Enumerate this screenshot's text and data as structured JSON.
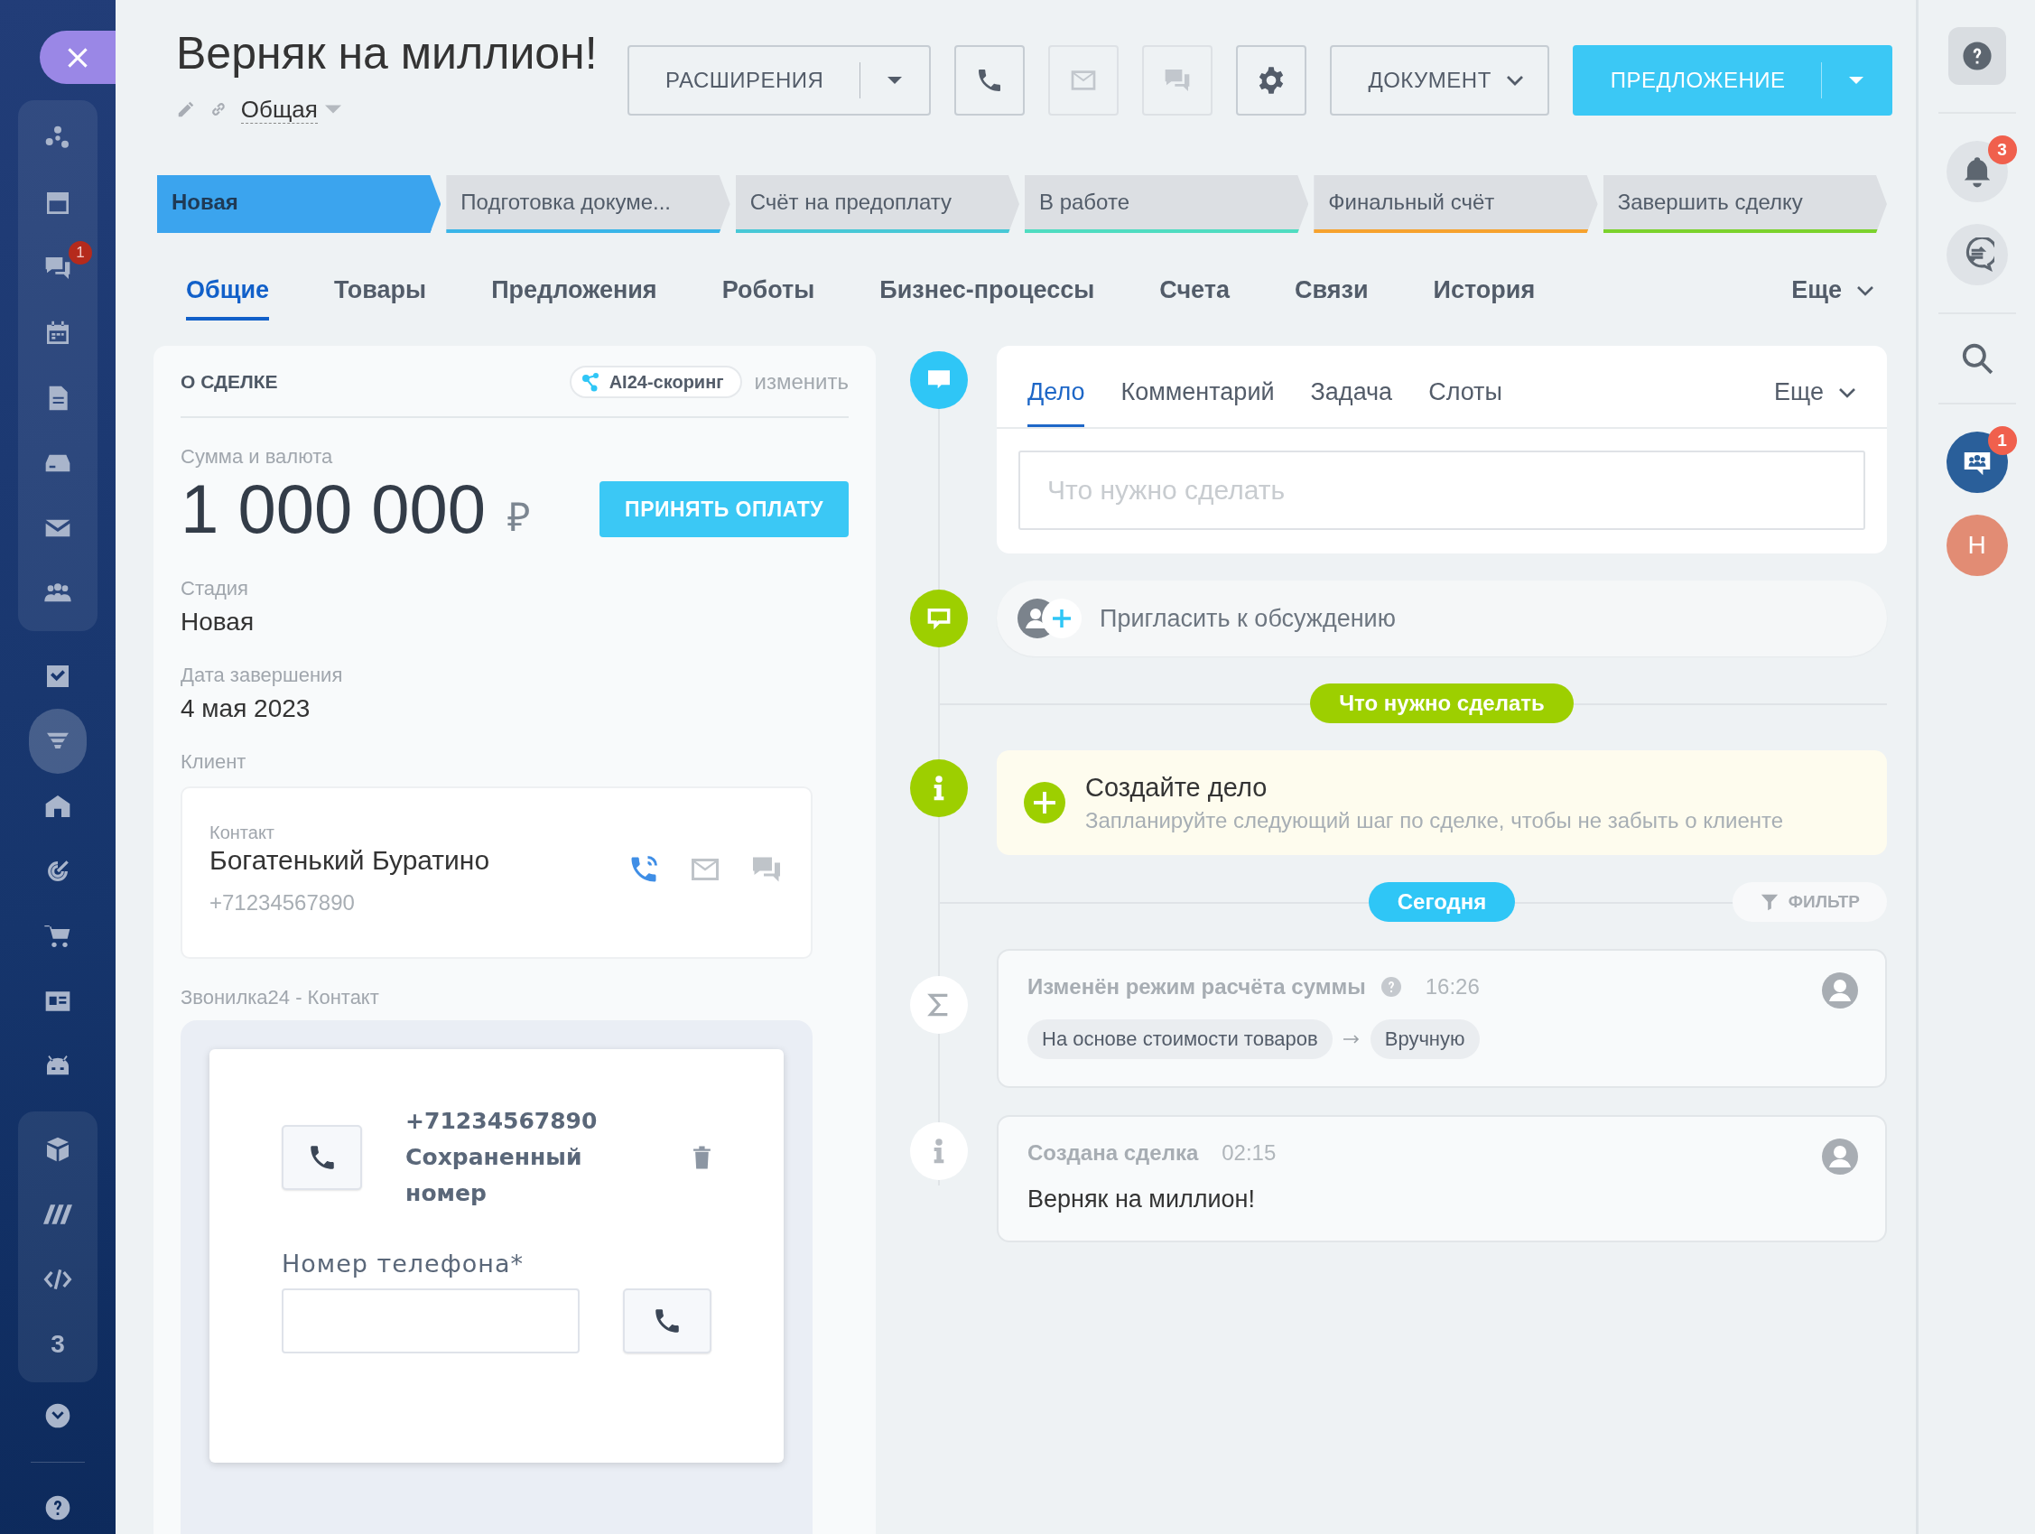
{
  "sidebar": {
    "groups": [
      {
        "boxed": true,
        "items": [
          {
            "selected": false
          },
          {
            "selected": false
          },
          {
            "selected": false,
            "badge": "1"
          },
          {
            "selected": false
          },
          {
            "selected": false
          },
          {
            "selected": false
          },
          {
            "selected": false
          },
          {
            "selected": false
          }
        ]
      },
      {
        "boxed": false,
        "items": [
          {
            "selected": false
          },
          {
            "selected": true
          },
          {
            "selected": false
          },
          {
            "selected": false
          },
          {
            "selected": false
          },
          {
            "selected": false
          },
          {
            "selected": false
          }
        ]
      },
      {
        "boxed": true,
        "items": [
          {
            "selected": false
          },
          {
            "selected": false
          },
          {
            "selected": false
          },
          {
            "selected": false,
            "text": "3"
          }
        ]
      }
    ]
  },
  "header": {
    "title": "Верняк на миллион!",
    "category": "Общая",
    "toolbar": [
      {
        "kind": "split",
        "label": "РАСШИРЕНИЯ",
        "primary": false
      },
      {
        "kind": "icon",
        "disabled": false
      },
      {
        "kind": "icon",
        "disabled": true
      },
      {
        "kind": "icon",
        "disabled": true
      },
      {
        "kind": "icon",
        "disabled": false
      },
      {
        "kind": "dropdown",
        "label": "ДОКУМЕНТ"
      },
      {
        "kind": "split",
        "label": "ПРЕДЛОЖЕНИЕ",
        "primary": true
      }
    ]
  },
  "stages": [
    {
      "label": "Новая",
      "selected": true,
      "color": "#3ba4ee"
    },
    {
      "label": "Подготовка докуме...",
      "selected": false,
      "color": "#39b5e8"
    },
    {
      "label": "Счёт на предоплату",
      "selected": false,
      "color": "#47c8d6"
    },
    {
      "label": "В работе",
      "selected": false,
      "color": "#4fdcc0"
    },
    {
      "label": "Финальный счёт",
      "selected": false,
      "color": "#f6a22e"
    },
    {
      "label": "Завершить сделку",
      "selected": false,
      "color": "#7bd22c"
    }
  ],
  "tabs": [
    {
      "label": "Общие",
      "selected": true
    },
    {
      "label": "Товары",
      "selected": false
    },
    {
      "label": "Предложения",
      "selected": false
    },
    {
      "label": "Роботы",
      "selected": false
    },
    {
      "label": "Бизнес-процессы",
      "selected": false
    },
    {
      "label": "Счета",
      "selected": false
    },
    {
      "label": "Связи",
      "selected": false
    },
    {
      "label": "История",
      "selected": false
    }
  ],
  "tabs_more": "Еще",
  "deal": {
    "title": "О СДЕЛКЕ",
    "scoring": "AI24-скоринг",
    "edit": "изменить",
    "amount_label": "Сумма и валюта",
    "amount": "1 000 000",
    "currency": "₽",
    "pay_button": "ПРИНЯТЬ ОПЛАТУ",
    "stage_label": "Стадия",
    "stage": "Новая",
    "date_label": "Дата завершения",
    "date": "4 мая 2023",
    "client_label": "Клиент",
    "contact": {
      "caption": "Контакт",
      "name": "Богатенький Буратино",
      "phone": "+71234567890"
    },
    "widget_label": "Звонилка24 - Контакт",
    "widget": {
      "phone": "+71234567890",
      "note": "Сохраненный номер",
      "field_label": "Номер телефона*"
    }
  },
  "timeline": {
    "composer": {
      "tabs": [
        {
          "label": "Дело",
          "selected": true
        },
        {
          "label": "Комментарий",
          "selected": false
        },
        {
          "label": "Задача",
          "selected": false
        },
        {
          "label": "Слоты",
          "selected": false
        }
      ],
      "more": "Еще",
      "placeholder": "Что нужно сделать"
    },
    "invite": "Пригласить к обсуждению",
    "todo_divider": "Что нужно сделать",
    "create": {
      "title": "Создайте дело",
      "text": "Запланируйте следующий шаг по сделке, чтобы не забыть о клиенте"
    },
    "today_divider": "Сегодня",
    "filter": "ФИЛЬТР",
    "events": [
      {
        "kind": "change",
        "title": "Изменён режим расчёта суммы",
        "time": "16:26",
        "from": "На основе стоимости товаров",
        "to": "Вручную"
      },
      {
        "kind": "info",
        "title": "Создана сделка",
        "time": "02:15",
        "text": "Верняк на миллион!"
      }
    ]
  },
  "rail": {
    "notifications_badge": "3",
    "chat_badge": "1",
    "avatar": "Н"
  }
}
